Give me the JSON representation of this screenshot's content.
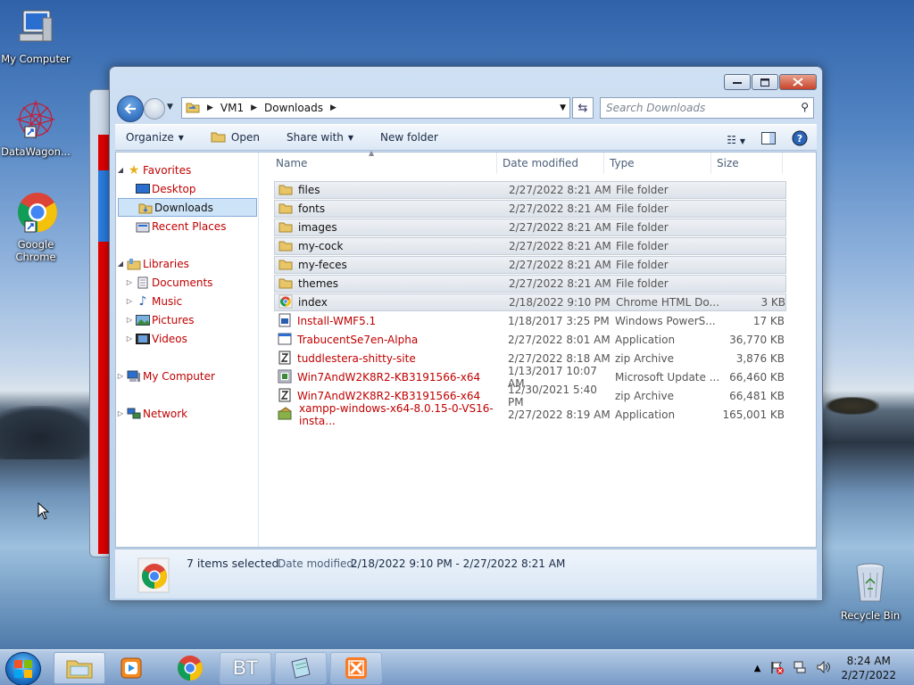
{
  "desktop": {
    "icons": [
      {
        "label": "My Computer"
      },
      {
        "label": "DataWagon..."
      },
      {
        "label": "Google Chrome"
      },
      {
        "label": "Recycle Bin"
      }
    ]
  },
  "window": {
    "address": {
      "segments": [
        "VM1",
        "Downloads"
      ]
    },
    "search_placeholder": "Search Downloads",
    "toolbar": {
      "organize": "Organize",
      "open": "Open",
      "share_with": "Share with",
      "new_folder": "New folder"
    },
    "nav": {
      "favorites": "Favorites",
      "desktop": "Desktop",
      "downloads": "Downloads",
      "recent_places": "Recent Places",
      "libraries": "Libraries",
      "documents": "Documents",
      "music": "Music",
      "pictures": "Pictures",
      "videos": "Videos",
      "my_computer": "My Computer",
      "network": "Network"
    },
    "columns": {
      "name": "Name",
      "date": "Date modified",
      "type": "Type",
      "size": "Size"
    },
    "files": [
      {
        "name": "files",
        "date": "2/27/2022 8:21 AM",
        "type": "File folder",
        "size": "",
        "icon": "folder-icon",
        "selected": true,
        "red": false
      },
      {
        "name": "fonts",
        "date": "2/27/2022 8:21 AM",
        "type": "File folder",
        "size": "",
        "icon": "folder-icon",
        "selected": true,
        "red": false
      },
      {
        "name": "images",
        "date": "2/27/2022 8:21 AM",
        "type": "File folder",
        "size": "",
        "icon": "folder-icon",
        "selected": true,
        "red": false
      },
      {
        "name": "my-cock",
        "date": "2/27/2022 8:21 AM",
        "type": "File folder",
        "size": "",
        "icon": "folder-icon",
        "selected": true,
        "red": false
      },
      {
        "name": "my-feces",
        "date": "2/27/2022 8:21 AM",
        "type": "File folder",
        "size": "",
        "icon": "folder-icon",
        "selected": true,
        "red": false
      },
      {
        "name": "themes",
        "date": "2/27/2022 8:21 AM",
        "type": "File folder",
        "size": "",
        "icon": "folder-icon",
        "selected": true,
        "red": false
      },
      {
        "name": "index",
        "date": "2/18/2022 9:10 PM",
        "type": "Chrome HTML Do...",
        "size": "3 KB",
        "icon": "chrome-html-icon",
        "selected": true,
        "red": false
      },
      {
        "name": "Install-WMF5.1",
        "date": "1/18/2017 3:25 PM",
        "type": "Windows PowerS...",
        "size": "17 KB",
        "icon": "powershell-script-icon",
        "selected": false,
        "red": true
      },
      {
        "name": "TrabucentSe7en-Alpha",
        "date": "2/27/2022 8:01 AM",
        "type": "Application",
        "size": "36,770 KB",
        "icon": "application-icon",
        "selected": false,
        "red": true
      },
      {
        "name": "tuddlestera-shitty-site",
        "date": "2/27/2022 8:18 AM",
        "type": "zip Archive",
        "size": "3,876 KB",
        "icon": "zip-icon",
        "selected": false,
        "red": true
      },
      {
        "name": "Win7AndW2K8R2-KB3191566-x64",
        "date": "1/13/2017 10:07 AM",
        "type": "Microsoft Update ...",
        "size": "66,460 KB",
        "icon": "update-package-icon",
        "selected": false,
        "red": true
      },
      {
        "name": "Win7AndW2K8R2-KB3191566-x64",
        "date": "12/30/2021 5:40 PM",
        "type": "zip Archive",
        "size": "66,481 KB",
        "icon": "zip-icon",
        "selected": false,
        "red": true
      },
      {
        "name": "xampp-windows-x64-8.0.15-0-VS16-insta...",
        "date": "2/27/2022 8:19 AM",
        "type": "Application",
        "size": "165,001 KB",
        "icon": "installer-icon",
        "selected": false,
        "red": true
      }
    ],
    "status": {
      "selected_count": "7 items selected",
      "date_label": "Date modified:",
      "date_value": "2/18/2022 9:10 PM - 2/27/2022 8:21 AM"
    }
  },
  "taskbar": {
    "clock": {
      "time": "8:24 AM",
      "date": "2/27/2022"
    },
    "apps": [
      "explorer",
      "media-player",
      "chrome",
      "bt",
      "notepad",
      "xampp"
    ],
    "bt_label": "BT"
  }
}
